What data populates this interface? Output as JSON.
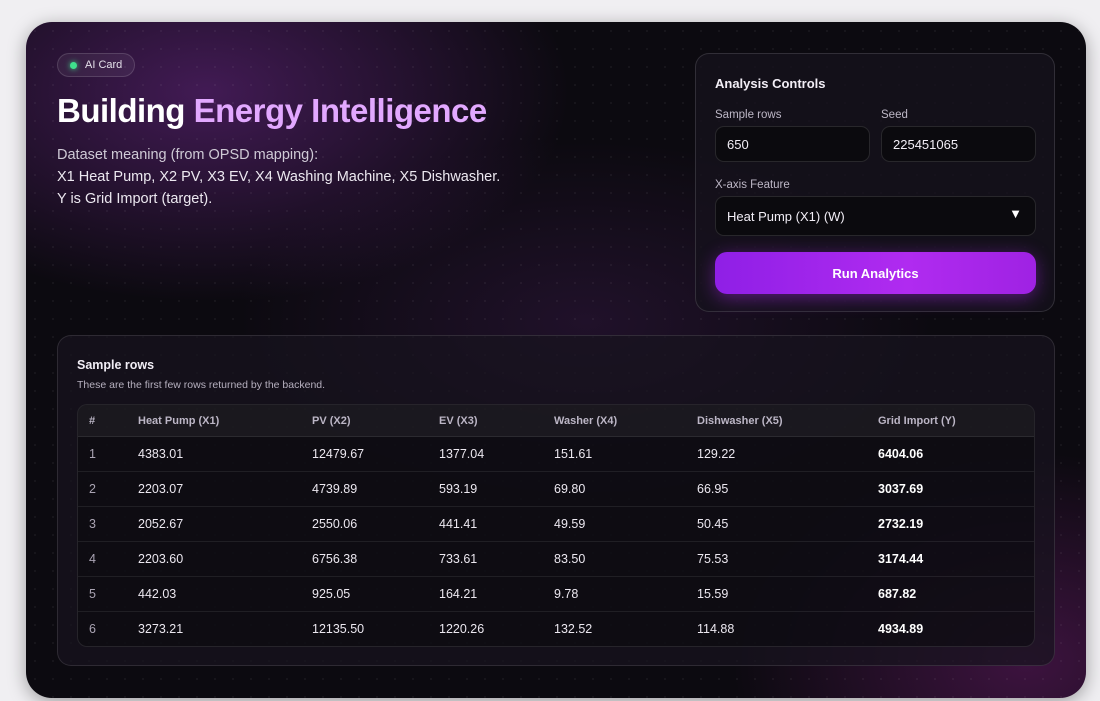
{
  "hero": {
    "badge": "AI Card",
    "title_part1": "Building",
    "title_part2": "Energy Intelligence",
    "desc_line1": "Dataset meaning (from OPSD mapping):",
    "desc_line2": "X1 Heat Pump, X2 PV, X3 EV, X4 Washing Machine, X5 Dishwasher.",
    "desc_line3": "Y is Grid Import (target)."
  },
  "controls": {
    "heading": "Analysis Controls",
    "sample_rows_label": "Sample rows",
    "sample_rows_value": "650",
    "seed_label": "Seed",
    "seed_value": "225451065",
    "xaxis_label": "X-axis Feature",
    "xaxis_value": "Heat Pump (X1) (W)",
    "run_button": "Run Analytics"
  },
  "table": {
    "heading": "Sample rows",
    "subtitle": "These are the first few rows returned by the backend.",
    "columns": [
      "#",
      "Heat Pump (X1)",
      "PV (X2)",
      "EV (X3)",
      "Washer (X4)",
      "Dishwasher (X5)",
      "Grid Import (Y)"
    ],
    "rows": [
      [
        "1",
        "4383.01",
        "12479.67",
        "1377.04",
        "151.61",
        "129.22",
        "6404.06"
      ],
      [
        "2",
        "2203.07",
        "4739.89",
        "593.19",
        "69.80",
        "66.95",
        "3037.69"
      ],
      [
        "3",
        "2052.67",
        "2550.06",
        "441.41",
        "49.59",
        "50.45",
        "2732.19"
      ],
      [
        "4",
        "2203.60",
        "6756.38",
        "733.61",
        "83.50",
        "75.53",
        "3174.44"
      ],
      [
        "5",
        "442.03",
        "925.05",
        "164.21",
        "9.78",
        "15.59",
        "687.82"
      ],
      [
        "6",
        "3273.21",
        "12135.50",
        "1220.26",
        "132.52",
        "114.88",
        "4934.89"
      ]
    ]
  }
}
